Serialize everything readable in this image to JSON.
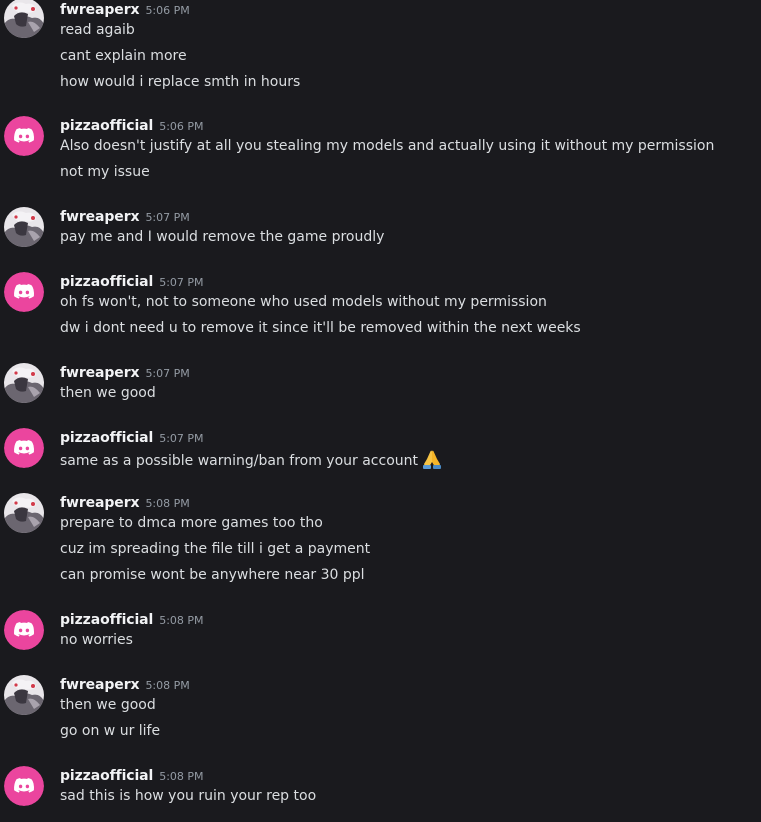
{
  "users": {
    "fwreaperx": {
      "name": "fwreaperx",
      "avatar_icon": "anime-avatar-icon"
    },
    "pizzaofficial": {
      "name": "pizzaofficial",
      "avatar_icon": "discord-logo-icon",
      "avatar_color": "#eb459e"
    }
  },
  "messages": [
    {
      "author": "fwreaperx",
      "time": "5:06 PM",
      "lines": [
        "read agaib",
        "cant explain more",
        "how would i replace smth in hours"
      ]
    },
    {
      "author": "pizzaofficial",
      "time": "5:06 PM",
      "lines": [
        "Also doesn't justify at all you stealing my models and actually using it without my permission",
        "not my issue"
      ]
    },
    {
      "author": "fwreaperx",
      "time": "5:07 PM",
      "lines": [
        "pay me and I would remove the game proudly"
      ]
    },
    {
      "author": "pizzaofficial",
      "time": "5:07 PM",
      "lines": [
        "oh fs won't, not to someone who used models without my permission",
        "dw i dont need u to remove it since it'll be removed within the next weeks"
      ]
    },
    {
      "author": "fwreaperx",
      "time": "5:07 PM",
      "lines": [
        "then we good"
      ]
    },
    {
      "author": "pizzaofficial",
      "time": "5:07 PM",
      "lines": [
        "same as a possible warning/ban from your account"
      ],
      "emoji": "folded-hands-icon"
    },
    {
      "author": "fwreaperx",
      "time": "5:08 PM",
      "lines": [
        "prepare to dmca more games too tho",
        "cuz im spreading the file till i get a payment",
        "can promise wont be anywhere near 30 ppl"
      ]
    },
    {
      "author": "pizzaofficial",
      "time": "5:08 PM",
      "lines": [
        "no worries"
      ]
    },
    {
      "author": "fwreaperx",
      "time": "5:08 PM",
      "lines": [
        "then we good",
        "go on w ur life"
      ]
    },
    {
      "author": "pizzaofficial",
      "time": "5:08 PM",
      "lines": [
        "sad this is how you ruin your rep too"
      ]
    }
  ]
}
